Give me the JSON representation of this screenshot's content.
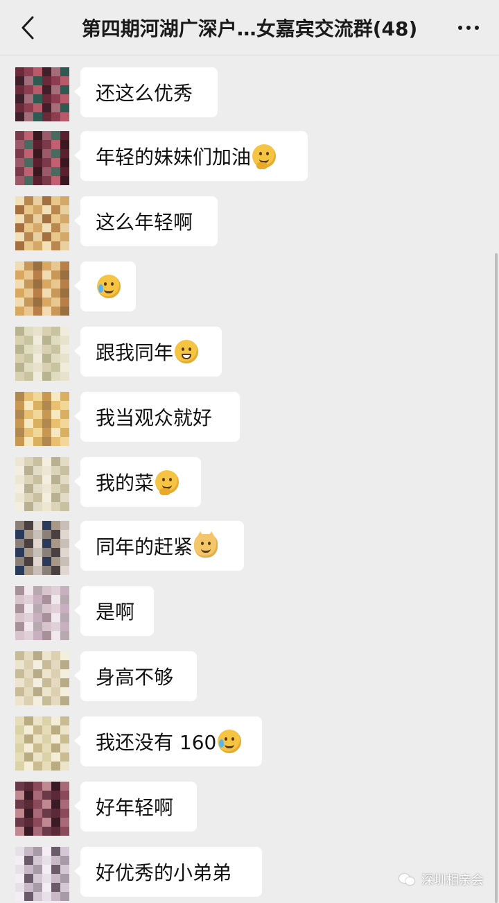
{
  "header": {
    "title": "第四期河湖广深户…女嘉宾交流群(48)",
    "back_icon": "chevron-left-icon",
    "more_icon": "more-dots-icon"
  },
  "messages": [
    {
      "text": "还这么优秀",
      "emoji": null,
      "avatar_palette": [
        "#6b2a3a",
        "#8c3d4f",
        "#b85a6a",
        "#3e1f2a",
        "#a46d7a",
        "#2f5a52"
      ]
    },
    {
      "text": "年轻的妹妹们加油",
      "emoji": "thinking",
      "avatar_palette": [
        "#5a2030",
        "#7a3a4a",
        "#c06070",
        "#3a1822",
        "#9a5a68",
        "#4a6a60"
      ]
    },
    {
      "text": "这么年轻啊",
      "emoji": null,
      "avatar_palette": [
        "#e8c88a",
        "#d4a868",
        "#f2e0b8",
        "#b88850",
        "#e8d0a0",
        "#a47040"
      ]
    },
    {
      "text": "",
      "emoji": "crying-laughing",
      "avatar_palette": [
        "#d8a860",
        "#e8c890",
        "#b88048",
        "#f0dcb0",
        "#c89858",
        "#9a7040"
      ]
    },
    {
      "text": "跟我同年",
      "emoji": "grin",
      "avatar_palette": [
        "#e8e2cc",
        "#d8d0b0",
        "#c8c4a0",
        "#f0ecdc",
        "#b8b490",
        "#e0dcc0"
      ]
    },
    {
      "text": "我当观众就好",
      "emoji": null,
      "avatar_palette": [
        "#e8c070",
        "#f2d898",
        "#c89850",
        "#f6e8c0",
        "#d8b060",
        "#b08850"
      ]
    },
    {
      "text": "我的菜",
      "emoji": "thinking",
      "avatar_palette": [
        "#ece6d2",
        "#dcd4b8",
        "#c8c0a0",
        "#f2eee0",
        "#b8b090",
        "#e2dcc6"
      ]
    },
    {
      "text": "同年的赶紧",
      "emoji": "cat",
      "avatar_palette": [
        "#c8c0b8",
        "#8a8078",
        "#4a4040",
        "#e0d8d0",
        "#2a3a5a",
        "#a89888"
      ]
    },
    {
      "text": "是啊",
      "emoji": null,
      "avatar_palette": [
        "#e0d0d8",
        "#c8b0c0",
        "#a89098",
        "#f0e8ec",
        "#b8a8b0",
        "#d8c4cc"
      ]
    },
    {
      "text": "身高不够",
      "emoji": null,
      "avatar_palette": [
        "#ece4cc",
        "#dcd0b0",
        "#f4eede",
        "#c8bc98",
        "#e4dac0",
        "#b8ac88"
      ]
    },
    {
      "text": "我还没有 160",
      "emoji": "crying-laughing",
      "avatar_palette": [
        "#ece4c8",
        "#dcd2a8",
        "#f4eed8",
        "#c8bc90",
        "#e6dcb8",
        "#b8ac80"
      ]
    },
    {
      "text": "好年轻啊",
      "emoji": null,
      "avatar_palette": [
        "#5a2a38",
        "#8a4a5a",
        "#c08890",
        "#3a1a24",
        "#a86a78",
        "#6a3a48"
      ]
    },
    {
      "text": "好优秀的小弟弟",
      "emoji": null,
      "avatar_palette": [
        "#e8e0e8",
        "#c8b8c8",
        "#a89aa8",
        "#f4eef4",
        "#6a5a6a",
        "#d4c8d4"
      ]
    }
  ],
  "watermark": {
    "text": "深圳相亲会",
    "icon": "wechat-icon"
  }
}
